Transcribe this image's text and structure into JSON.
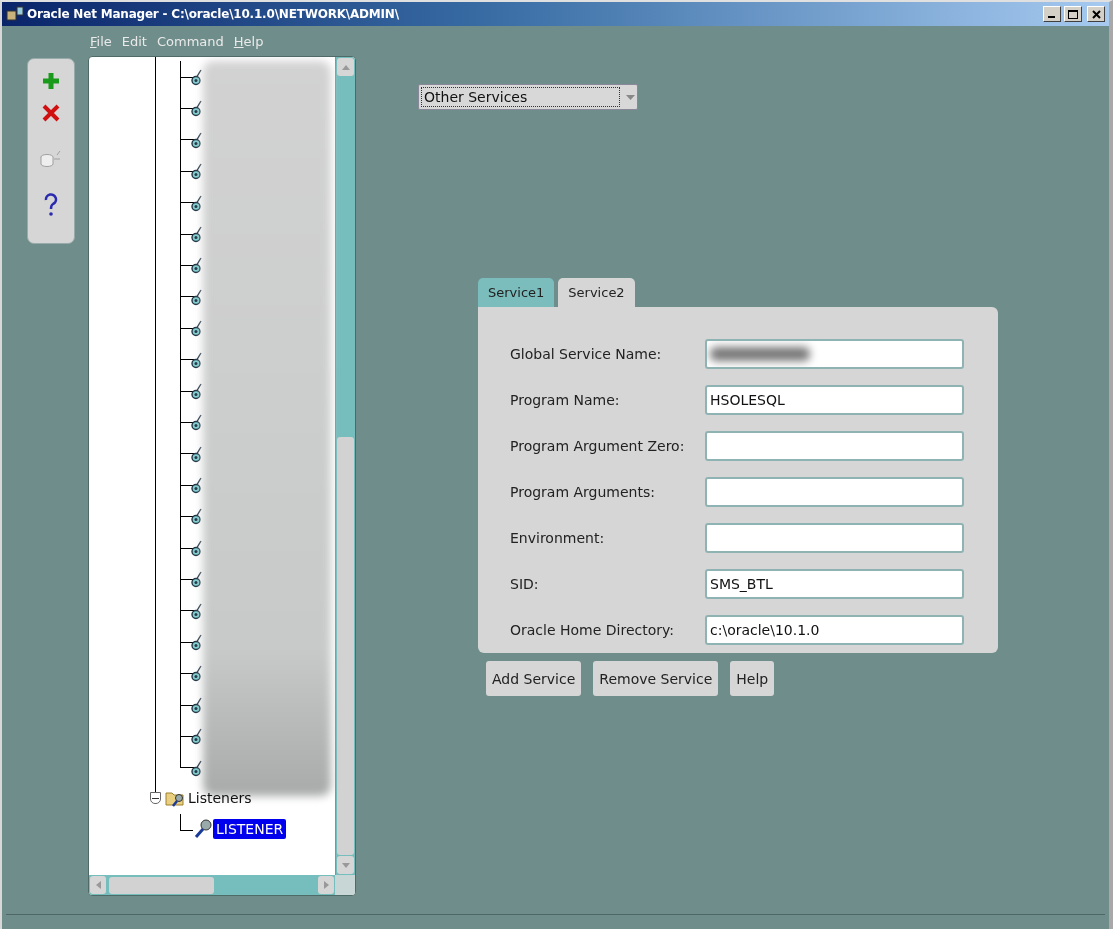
{
  "window": {
    "title": "Oracle Net Manager - C:\\oracle\\10.1.0\\NETWORK\\ADMIN\\"
  },
  "menu": [
    {
      "label": "File",
      "underlined": true
    },
    {
      "label": "Edit",
      "underlined": false
    },
    {
      "label": "Command",
      "underlined": false
    },
    {
      "label": "Help",
      "underlined": true
    }
  ],
  "toolbar": [
    {
      "kind": "add",
      "disabled": false
    },
    {
      "kind": "remove",
      "disabled": false
    },
    {
      "kind": "test",
      "disabled": true
    },
    {
      "kind": "help",
      "disabled": false
    }
  ],
  "tree": {
    "services_redacted": true,
    "services": [
      {
        "kind": "service"
      },
      {
        "kind": "service"
      },
      {
        "kind": "service"
      },
      {
        "kind": "service"
      },
      {
        "kind": "service"
      },
      {
        "kind": "service"
      },
      {
        "kind": "service"
      },
      {
        "kind": "service"
      },
      {
        "kind": "service"
      },
      {
        "kind": "service"
      },
      {
        "kind": "service"
      },
      {
        "kind": "service"
      },
      {
        "kind": "service"
      },
      {
        "kind": "service"
      },
      {
        "kind": "service"
      },
      {
        "kind": "service"
      },
      {
        "kind": "service"
      },
      {
        "kind": "service"
      },
      {
        "kind": "service"
      },
      {
        "kind": "service"
      },
      {
        "kind": "service"
      },
      {
        "kind": "service"
      },
      {
        "kind": "service"
      }
    ],
    "items": [
      {
        "label": "Listeners",
        "expanded": true,
        "selected": false,
        "children": [
          {
            "label": "LISTENER",
            "selected": true
          }
        ]
      }
    ]
  },
  "service_type": {
    "value": "Other Services"
  },
  "tabs": [
    {
      "label": "Service1",
      "selected": false
    },
    {
      "label": "Service2",
      "selected": true
    }
  ],
  "fields": [
    {
      "label": "Global Service Name:",
      "redacted": true
    },
    {
      "label": "Program Name:",
      "value": "HSOLESQL",
      "redacted": false
    },
    {
      "label": "Program Argument Zero:",
      "redacted": false
    },
    {
      "label": "Program Arguments:",
      "redacted": false
    },
    {
      "label": "Environment:",
      "redacted": false
    },
    {
      "label": "SID:",
      "value": "SMS_BTL",
      "redacted": false
    },
    {
      "label": "Oracle Home Directory:",
      "value": "c:\\oracle\\10.1.0",
      "redacted": false
    }
  ],
  "buttons": [
    "Add Service",
    "Remove Service",
    "Help"
  ]
}
